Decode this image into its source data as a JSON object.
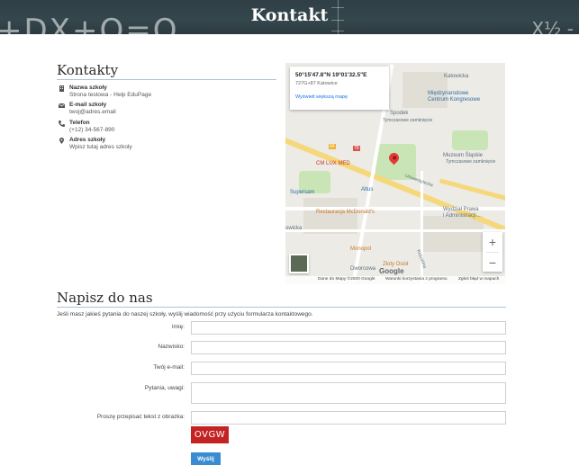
{
  "header": {
    "title": "Kontakt",
    "chalk_left": "+DX+Q=O",
    "chalk_right": "X½ -"
  },
  "contacts": {
    "title": "Kontakty",
    "items": [
      {
        "icon": "building-icon",
        "label": "Nazwa szkoły",
        "value": "Strona testowa - Help EduPage"
      },
      {
        "icon": "envelope-icon",
        "label": "E-mail szkoły",
        "value": "twoj@adres.email"
      },
      {
        "icon": "phone-icon",
        "label": "Telefon",
        "value": "(+12) 34-567-890"
      },
      {
        "icon": "location-pin-icon",
        "label": "Adres szkoły",
        "value": "Wpisz tutaj adres szkoły"
      }
    ]
  },
  "map": {
    "coordinates": "50°15'47.8\"N 19°01'32.5\"E",
    "plus_code": "727G+87 Katowice",
    "larger_map_link": "Wyświetl większą mapę",
    "labels": {
      "katowicka": "Katowicka",
      "mcc": "Międzynarodowe\nCentrum Kongresowe",
      "spodek": "Spodek",
      "tymczasowe1": "Tymczasowe zamknięcie",
      "tymczasowe2": "Tymczasowe zamknięcie",
      "muzeum": "Muzeum Śląskie",
      "cmlux": "CM LUX MED",
      "supersam": "Supersam",
      "altus": "Altus",
      "uniwersytecka": "Uniwersytecka",
      "mcdonalds": "Restauracja McDonald's",
      "wydzial": "Wydział Prawa\ni Administracji...",
      "owicka": "owicka",
      "monopol": "Monopol",
      "zloty": "Złoty Osioł",
      "dworcowa": "Dworcowa",
      "koscienna": "Kościelna",
      "w94": "94",
      "w79": "79"
    },
    "zoom_in": "+",
    "zoom_out": "−",
    "logo": "Google",
    "footer": {
      "data": "Dane do Mapy ©2020 Google",
      "terms": "Warunki korzystania z programu",
      "report": "Zgłoś błąd w mapach"
    }
  },
  "form": {
    "title": "Napisz do nas",
    "intro": "Jeśli masz jakieś pytania do naszej szkoły, wyślij wiadomość przy użyciu formularza kontaktowego.",
    "fields": {
      "name_label": "Imię:",
      "surname_label": "Nazwisko:",
      "email_label": "Twój e-mail:",
      "question_label": "Pytania, uwagi:",
      "captcha_label": "Proszę przepisać tekst z obrazka:"
    },
    "captcha_text": "OVGW",
    "submit_label": "Wyślij"
  }
}
